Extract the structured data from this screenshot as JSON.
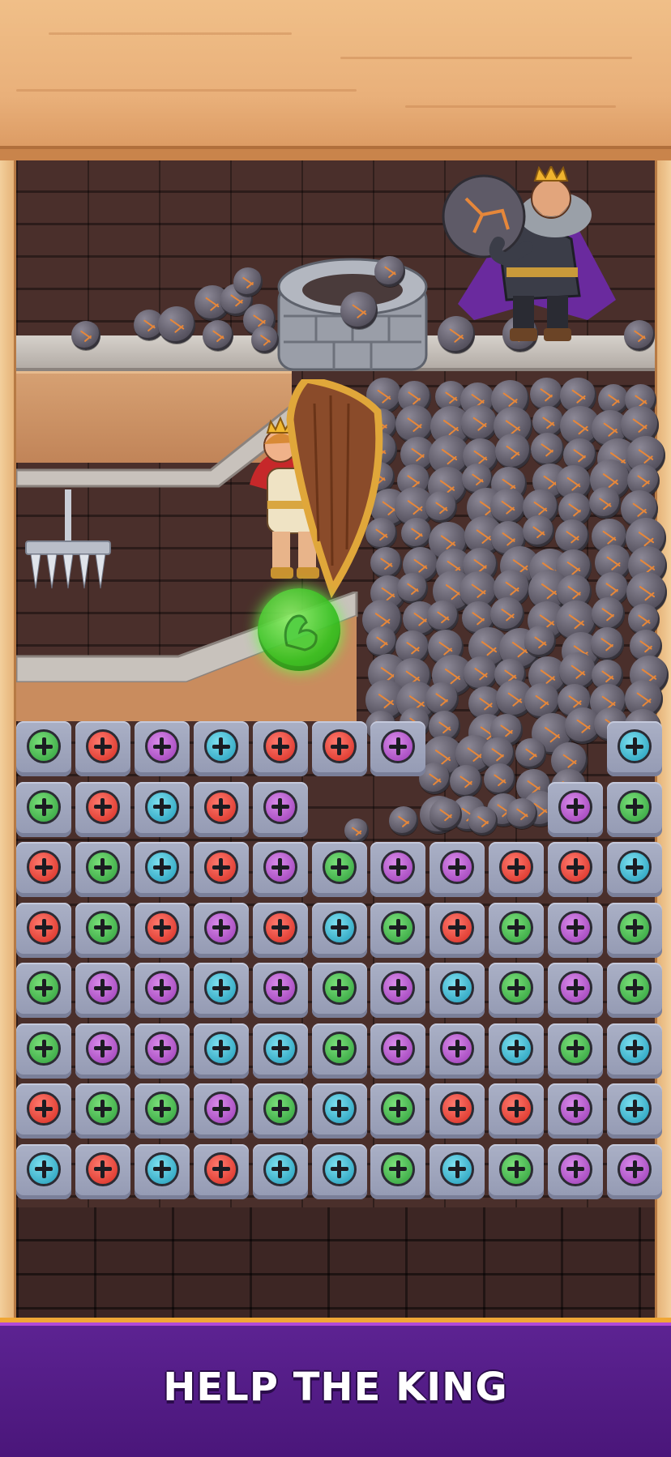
{
  "banner": {
    "title": "HELP THE KING"
  },
  "colors": {
    "banner_bg": "#4f1a82",
    "banner_border": "#f0a736",
    "wood": "#e9b07a",
    "brick": "#4a2f2b",
    "screw_green": "#2e9e3b",
    "screw_red": "#d62b21",
    "screw_purple": "#9a3bb5",
    "screw_cyan": "#1f9ab8"
  },
  "board": {
    "rows": [
      [
        "green",
        "red",
        "purple",
        "cyan",
        "red",
        "red",
        "purple",
        null,
        null,
        null,
        "cyan"
      ],
      [
        "green",
        "red",
        "cyan",
        "red",
        "purple",
        null,
        null,
        null,
        null,
        "purple",
        "green"
      ],
      [
        "red",
        "green",
        "cyan",
        "red",
        "purple",
        "green",
        "purple",
        "purple",
        "red",
        "red",
        "cyan"
      ],
      [
        "red",
        "green",
        "red",
        "purple",
        "red",
        "cyan",
        "green",
        "red",
        "green",
        "purple",
        "green"
      ],
      [
        "green",
        "purple",
        "purple",
        "cyan",
        "purple",
        "green",
        "purple",
        "cyan",
        "green",
        "purple",
        "green"
      ],
      [
        "green",
        "purple",
        "purple",
        "cyan",
        "cyan",
        "green",
        "purple",
        "purple",
        "cyan",
        "green",
        "cyan"
      ],
      [
        "red",
        "green",
        "green",
        "purple",
        "green",
        "cyan",
        "green",
        "red",
        "red",
        "purple",
        "cyan"
      ],
      [
        "cyan",
        "red",
        "cyan",
        "red",
        "cyan",
        "cyan",
        "green",
        "cyan",
        "green",
        "purple",
        "purple"
      ]
    ]
  },
  "icons": {
    "hero": "king-hero-with-shield",
    "enemy": "evil-king-with-boulder",
    "powerup": "strength-arm-icon",
    "trap": "spike-trap-icon",
    "well": "stone-well"
  }
}
